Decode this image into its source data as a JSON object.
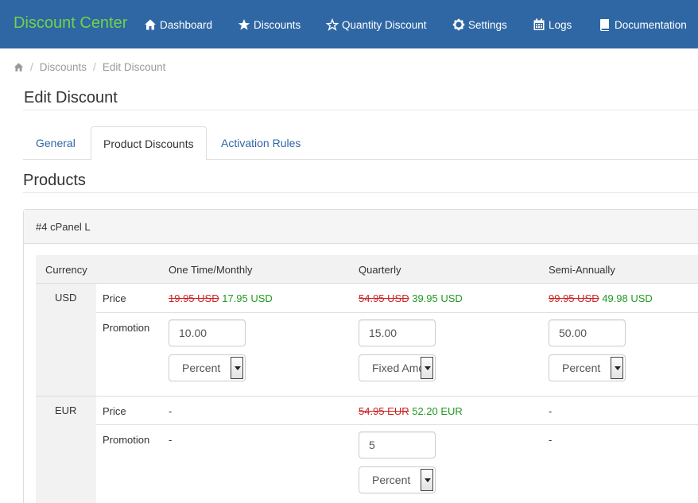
{
  "nav": {
    "brand": "Discount Center",
    "items": [
      {
        "label": "Dashboard",
        "icon": "home-icon"
      },
      {
        "label": "Discounts",
        "icon": "star-icon"
      },
      {
        "label": "Quantity Discount",
        "icon": "star-outline-icon"
      },
      {
        "label": "Settings",
        "icon": "gear-icon"
      },
      {
        "label": "Logs",
        "icon": "calendar-icon"
      },
      {
        "label": "Documentation",
        "icon": "book-icon"
      }
    ]
  },
  "breadcrumb": {
    "icon": "home-icon",
    "items": [
      "Discounts",
      "Edit Discount"
    ]
  },
  "page_title": "Edit Discount",
  "tabs": [
    {
      "label": "General",
      "active": false
    },
    {
      "label": "Product Discounts",
      "active": true
    },
    {
      "label": "Activation Rules",
      "active": false
    }
  ],
  "section_title": "Products",
  "product": {
    "heading": "#4 cPanel L",
    "columns": [
      "Currency",
      "One Time/Monthly",
      "Quarterly",
      "Semi-Annually"
    ],
    "row_labels": {
      "price": "Price",
      "promotion": "Promotion"
    },
    "usd": {
      "currency": "USD",
      "prices": [
        {
          "old": "19.95 USD",
          "new": "17.95 USD"
        },
        {
          "old": "54.95 USD",
          "new": "39.95 USD"
        },
        {
          "old": "99.95 USD",
          "new": "49.98 USD"
        }
      ],
      "promotions": [
        {
          "value": "10.00",
          "type": "Percent"
        },
        {
          "value": "15.00",
          "type": "Fixed Amount"
        },
        {
          "value": "50.00",
          "type": "Percent"
        }
      ]
    },
    "eur": {
      "currency": "EUR",
      "monthly_price": "-",
      "monthly_promotion": "-",
      "quarterly_price": {
        "old": "54.95 EUR",
        "new": "52.20 EUR"
      },
      "quarterly_promotion": {
        "value": "5",
        "type": "Percent"
      },
      "semi_price": "-",
      "semi_promotion": "-"
    }
  },
  "colors": {
    "navbar": "#2f67a4",
    "brand": "#6fd34a",
    "link": "#2f67a4",
    "old_price": "#cc2222",
    "new_price": "#229922"
  }
}
